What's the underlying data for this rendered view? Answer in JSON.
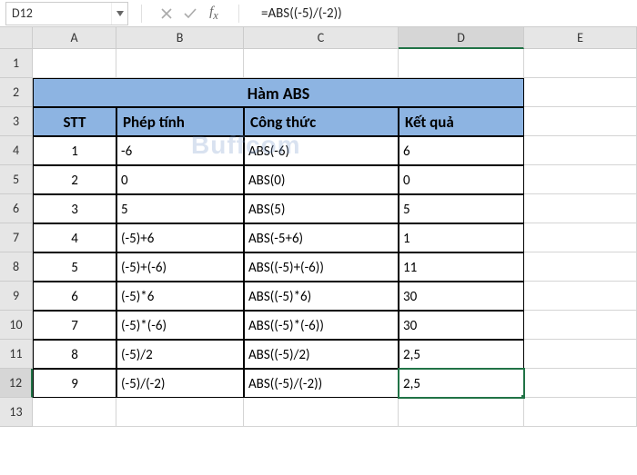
{
  "name_box": "D12",
  "formula": "=ABS((-5)/(-2))",
  "columns": [
    "A",
    "B",
    "C",
    "D",
    "E"
  ],
  "rows": [
    "1",
    "2",
    "3",
    "4",
    "5",
    "6",
    "7",
    "8",
    "9",
    "10",
    "11",
    "12",
    "13"
  ],
  "active_col": "D",
  "active_row": "12",
  "table": {
    "title": "Hàm ABS",
    "headers": {
      "stt": "STT",
      "phep": "Phép tính",
      "cong": "Công thức",
      "ket": "Kết quả"
    },
    "rows": [
      {
        "stt": "1",
        "phep": "-6",
        "cong": "ABS(-6)",
        "ket": "6"
      },
      {
        "stt": "2",
        "phep": "0",
        "cong": "ABS(0)",
        "ket": "0"
      },
      {
        "stt": "3",
        "phep": "5",
        "cong": "ABS(5)",
        "ket": "5"
      },
      {
        "stt": "4",
        "phep": "(-5)+6",
        "cong": "ABS(-5+6)",
        "ket": "1"
      },
      {
        "stt": "5",
        "phep": "(-5)+(-6)",
        "cong": "ABS((-5)+(-6))",
        "ket": "11"
      },
      {
        "stt": "6",
        "phep": "(-5)*6",
        "cong": "ABS((-5)*6)",
        "ket": "30"
      },
      {
        "stt": "7",
        "phep": "(-5)*(-6)",
        "cong": "ABS((-5)*(-6))",
        "ket": "30"
      },
      {
        "stt": "8",
        "phep": "(-5)/2",
        "cong": "ABS((-5)/2)",
        "ket": "2,5"
      },
      {
        "stt": "9",
        "phep": "(-5)/(-2)",
        "cong": "ABS((-5)/(-2))",
        "ket": "2,5"
      }
    ]
  },
  "watermark": "Buffcom"
}
